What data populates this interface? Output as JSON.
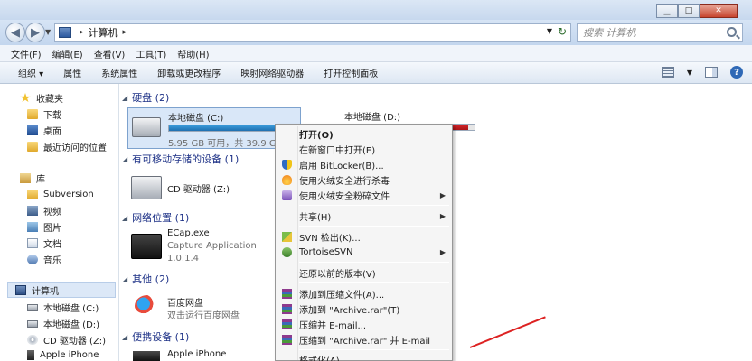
{
  "window": {
    "buttons": {
      "minimize": "▁",
      "maximize": "□",
      "close": "✕"
    }
  },
  "address": {
    "path": [
      "计算机"
    ],
    "search_placeholder": "搜索 计算机"
  },
  "menu": [
    "文件(F)",
    "编辑(E)",
    "查看(V)",
    "工具(T)",
    "帮助(H)"
  ],
  "toolbar": [
    "组织 ▾",
    "属性",
    "系统属性",
    "卸载或更改程序",
    "映射网络驱动器",
    "打开控制面板"
  ],
  "nav": {
    "favorites": {
      "title": "收藏夹",
      "items": [
        "下载",
        "桌面",
        "最近访问的位置"
      ]
    },
    "library": {
      "title": "库",
      "items": [
        "Subversion",
        "视频",
        "图片",
        "文档",
        "音乐"
      ]
    },
    "computer": {
      "title": "计算机",
      "items": [
        "本地磁盘 (C:)",
        "本地磁盘 (D:)",
        "CD 驱动器 (Z:)",
        "Apple iPhone"
      ]
    }
  },
  "groups": {
    "hdd": "硬盘 (2)",
    "removable": "有可移动存储的设备 (1)",
    "network": "网络位置 (1)",
    "other": "其他 (2)",
    "portable": "便携设备 (1)"
  },
  "drives": {
    "c": {
      "name": "本地磁盘 (C:)",
      "free": "5.95 GB 可用，共 39.9 GB",
      "used_fraction": 0.85
    },
    "d": {
      "name": "本地磁盘 (D:)",
      "used_fraction": 0.95
    }
  },
  "items": {
    "cd": {
      "name": "CD 驱动器 (Z:)"
    },
    "ecap": {
      "name": "ECap.exe",
      "line2": "Capture Application",
      "line3": "1.0.1.4"
    },
    "baidu": {
      "name": "百度网盘",
      "line2": "双击运行百度网盘"
    },
    "iphone": {
      "name": "Apple iPhone"
    }
  },
  "context_menu": {
    "open": "打开(O)",
    "open_new": "在新窗口中打开(E)",
    "bitlocker": "启用 BitLocker(B)...",
    "scan": "使用火绒安全进行杀毒",
    "shred": "使用火绒安全粉碎文件",
    "share": "共享(H)",
    "svn_checkout": "SVN 检出(K)...",
    "tortoise": "TortoiseSVN",
    "restore": "还原以前的版本(V)",
    "add_archive": "添加到压缩文件(A)...",
    "add_rar": "添加到 \"Archive.rar\"(T)",
    "compress_email": "压缩并 E-mail...",
    "compress_rar_email": "压缩到 \"Archive.rar\" 并 E-mail",
    "format": "格式化(A)..."
  },
  "colors": {
    "accent": "#1e3287",
    "drive_c_fill": "#3a9ad9",
    "drive_d_fill": "#d8262b",
    "selection": "#d9e7f8"
  }
}
